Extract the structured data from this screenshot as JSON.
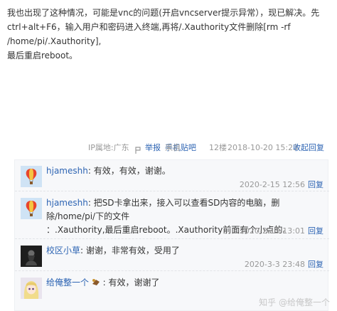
{
  "post": {
    "text_line1": "我也出现了这种情况，可能是vnc的问题(开启vncserver提示异常），现已解决。先",
    "text_line2": "ctrl+alt+F6，输入用户和密码进入终端,再将/.Xauthority文件删除[rm -rf /home/pi/.Xauthority],",
    "text_line3": "最后重启reboot。"
  },
  "meta": {
    "ip": "IP属地:广东",
    "report": "举报",
    "via_prefix": "来自",
    "via_link": "手机贴吧",
    "floor": "12楼",
    "datetime": "2018-10-20 15:23",
    "collapse_reply": "收起回复"
  },
  "comments": [
    {
      "user": "hjameshh",
      "text": "有效，有效，谢谢。",
      "time": "2020-2-15 12:56",
      "reply": "回复",
      "avatar": "hot-air-balloon"
    },
    {
      "user": "hjameshh",
      "text_line1": "把SD卡拿出来，接入可以查看SD内容的电脑，删除/home/pi/下的文件",
      "text_line2": "：.Xauthority,最后重启reboot。.Xauthority前面有个小点的。",
      "time": "2020-2-15 13:01",
      "reply": "回复",
      "avatar": "hot-air-balloon"
    },
    {
      "user": "校区小草",
      "text": "谢谢，非常有效，受用了",
      "time": "2020-3-3 23:48",
      "reply": "回复",
      "avatar": "dark-figure"
    },
    {
      "user": "给俺整一个",
      "text": "有效，谢谢了",
      "time": "",
      "reply": "",
      "avatar": "anime-girl"
    }
  ],
  "watermark": "知乎 @给俺整一个",
  "colors": {
    "link": "#2d64b3",
    "meta": "#999999",
    "comment_bg": "#f7f8fa",
    "text": "#333333"
  }
}
